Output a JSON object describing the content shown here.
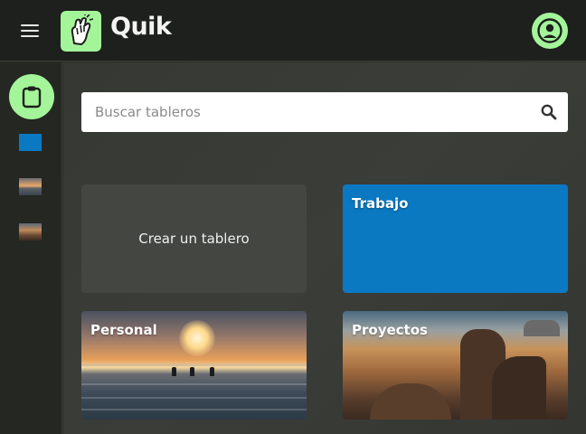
{
  "header": {
    "app_name": "Quik",
    "menu_icon": "hamburger-menu-icon",
    "logo_icon": "hand-logo-icon",
    "avatar_icon": "user-avatar-icon"
  },
  "sidebar": {
    "main_icon": "clipboard-icon",
    "boards": [
      {
        "name": "Trabajo",
        "color": "#0a79c2"
      },
      {
        "name": "Personal",
        "thumb": "beach-sunset"
      },
      {
        "name": "Proyectos",
        "thumb": "desert-rocks"
      }
    ]
  },
  "search": {
    "placeholder": "Buscar tableros",
    "value": "",
    "icon": "search-icon"
  },
  "cards": {
    "create_label": "Crear un tablero",
    "boards": [
      {
        "title": "Trabajo",
        "color": "#0a79c2"
      },
      {
        "title": "Personal"
      },
      {
        "title": "Proyectos"
      }
    ]
  },
  "colors": {
    "accent": "#a4f59a",
    "topbar": "#1e201d",
    "background": "#2c2e2a",
    "work_blue": "#0a79c2"
  }
}
